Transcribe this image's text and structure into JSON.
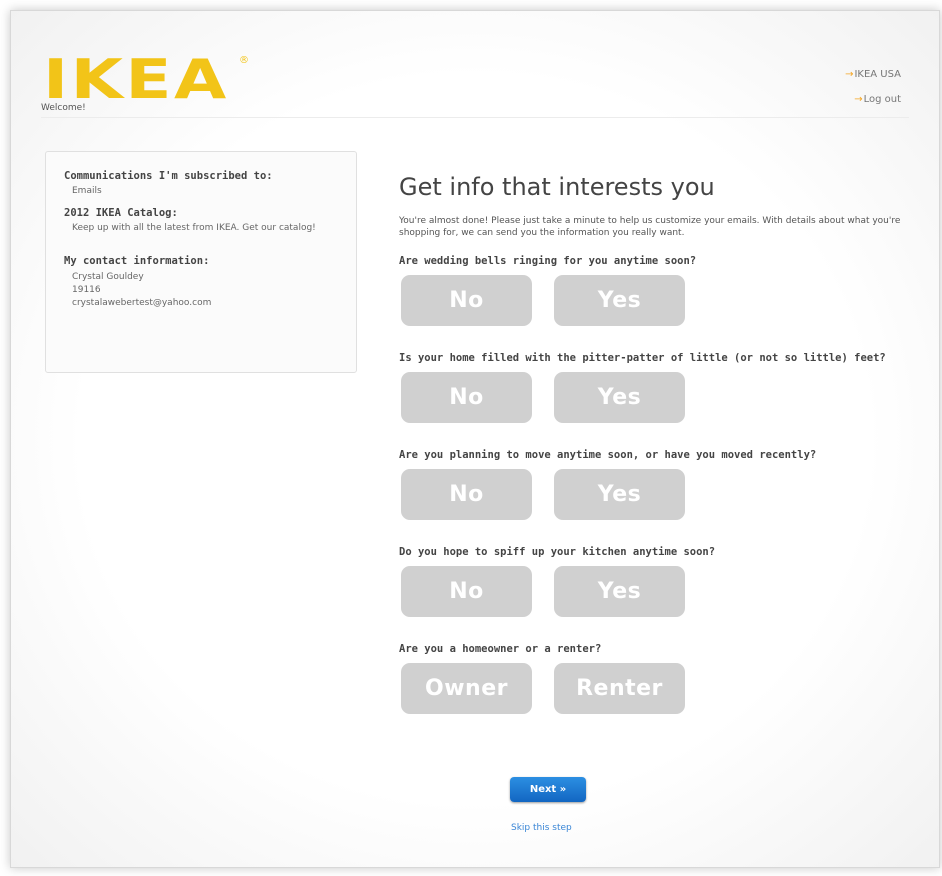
{
  "header": {
    "logo_text": "IKEA",
    "logo_reg": "®",
    "welcome": "Welcome!",
    "links": [
      {
        "arrow": "→",
        "label": "IKEA USA"
      },
      {
        "arrow": "→",
        "label": "Log out"
      }
    ]
  },
  "sidebar": {
    "subscriptions_heading": "Communications I'm subscribed to:",
    "subscriptions_value": "Emails",
    "catalog_heading": "2012 IKEA Catalog:",
    "catalog_text": "Keep up with all the latest from IKEA. Get our catalog!",
    "contact_heading": "My contact information:",
    "contact_name": "Crystal Gouldey",
    "contact_zip": "19116",
    "contact_email": "crystalawebertest@yahoo.com"
  },
  "main": {
    "title": "Get info that interests you",
    "intro": "You're almost done! Please just take a minute to help us customize your emails. With details about what you're shopping for, we can send you the information you really want.",
    "questions": [
      {
        "text": "Are wedding bells ringing for you anytime soon?",
        "options": [
          "No",
          "Yes"
        ]
      },
      {
        "text": "Is your home filled with the pitter-patter of little (or not so little) feet?",
        "options": [
          "No",
          "Yes"
        ]
      },
      {
        "text": "Are you planning to move anytime soon, or have you moved recently?",
        "options": [
          "No",
          "Yes"
        ]
      },
      {
        "text": "Do you hope to spiff up your kitchen anytime soon?",
        "options": [
          "No",
          "Yes"
        ]
      },
      {
        "text": "Are you a homeowner or a renter?",
        "options": [
          "Owner",
          "Renter"
        ]
      }
    ],
    "next_label": "Next »",
    "skip_label": "Skip this step"
  },
  "colors": {
    "brand_yellow": "#f2c418",
    "choice_gray": "#d0d0d0",
    "next_blue": "#1f7ed4",
    "link_orange": "#f5a623"
  }
}
